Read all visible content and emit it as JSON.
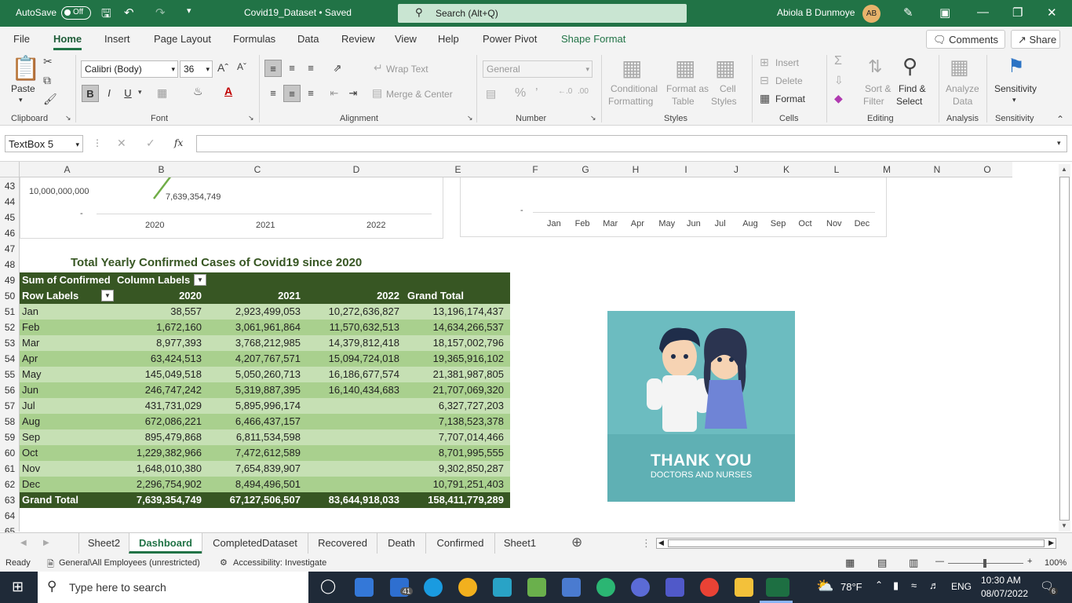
{
  "titlebar": {
    "autosave_label": "AutoSave",
    "autosave_state": "Off",
    "doc_title": "Covid19_Dataset • Saved",
    "search_placeholder": "Search (Alt+Q)",
    "user_name": "Abiola B Dunmoye",
    "user_initials": "AB"
  },
  "menu": {
    "items": [
      "File",
      "Home",
      "Insert",
      "Page Layout",
      "Formulas",
      "Data",
      "Review",
      "View",
      "Help",
      "Power Pivot",
      "Shape Format"
    ],
    "comments": "Comments",
    "share": "Share"
  },
  "ribbon": {
    "clipboard": {
      "paste": "Paste",
      "group": "Clipboard"
    },
    "font": {
      "family": "Calibri (Body)",
      "size": "36",
      "bold": "B",
      "italic": "I",
      "underline": "U",
      "group": "Font"
    },
    "alignment": {
      "wrap": "Wrap Text",
      "merge": "Merge & Center",
      "group": "Alignment"
    },
    "number": {
      "format": "General",
      "group": "Number"
    },
    "styles": {
      "conditional1": "Conditional",
      "conditional2": "Formatting",
      "format_as1": "Format as",
      "format_as2": "Table",
      "cell_styles1": "Cell",
      "cell_styles2": "Styles",
      "group": "Styles"
    },
    "cells": {
      "insert": "Insert",
      "delete": "Delete",
      "format": "Format",
      "group": "Cells"
    },
    "editing": {
      "sort1": "Sort &",
      "sort2": "Filter",
      "find1": "Find &",
      "find2": "Select",
      "group": "Editing"
    },
    "analysis": {
      "analyze1": "Analyze",
      "analyze2": "Data",
      "group": "Analysis"
    },
    "sensitivity": {
      "label": "Sensitivity",
      "group": "Sensitivity"
    }
  },
  "formula_bar": {
    "name_box": "TextBox 5",
    "fx": "fx",
    "formula": ""
  },
  "columns": [
    "A",
    "B",
    "C",
    "D",
    "E",
    "F",
    "G",
    "H",
    "I",
    "J",
    "K",
    "L",
    "M",
    "N",
    "O"
  ],
  "rows": [
    "43",
    "44",
    "45",
    "46",
    "47",
    "48",
    "49",
    "50",
    "51",
    "52",
    "53",
    "54",
    "55",
    "56",
    "57",
    "58",
    "59",
    "60",
    "61",
    "62",
    "63",
    "64",
    "65"
  ],
  "left_chart": {
    "y_tick_top": "10,000,000,000",
    "y_tick_zero": "-",
    "data_label": "7,639,354,749",
    "x_ticks": [
      "2020",
      "2021",
      "2022"
    ]
  },
  "right_chart": {
    "y_tick_zero": "-",
    "x_ticks": [
      "Jan",
      "Feb",
      "Mar",
      "Apr",
      "May",
      "Jun",
      "Jul",
      "Aug",
      "Sep",
      "Oct",
      "Nov",
      "Dec"
    ]
  },
  "pivot": {
    "title": "Total Yearly Confirmed Cases of Covid19 since 2020",
    "sum_label": "Sum of Confirmed",
    "col_labels": "Column Labels",
    "row_labels": "Row Labels",
    "headers": [
      "2020",
      "2021",
      "2022",
      "Grand Total"
    ],
    "rows": [
      {
        "m": "Jan",
        "y2020": "38,557",
        "y2021": "2,923,499,053",
        "y2022": "10,272,636,827",
        "total": "13,196,174,437"
      },
      {
        "m": "Feb",
        "y2020": "1,672,160",
        "y2021": "3,061,961,864",
        "y2022": "11,570,632,513",
        "total": "14,634,266,537"
      },
      {
        "m": "Mar",
        "y2020": "8,977,393",
        "y2021": "3,768,212,985",
        "y2022": "14,379,812,418",
        "total": "18,157,002,796"
      },
      {
        "m": "Apr",
        "y2020": "63,424,513",
        "y2021": "4,207,767,571",
        "y2022": "15,094,724,018",
        "total": "19,365,916,102"
      },
      {
        "m": "May",
        "y2020": "145,049,518",
        "y2021": "5,050,260,713",
        "y2022": "16,186,677,574",
        "total": "21,381,987,805"
      },
      {
        "m": "Jun",
        "y2020": "246,747,242",
        "y2021": "5,319,887,395",
        "y2022": "16,140,434,683",
        "total": "21,707,069,320"
      },
      {
        "m": "Jul",
        "y2020": "431,731,029",
        "y2021": "5,895,996,174",
        "y2022": "",
        "total": "6,327,727,203"
      },
      {
        "m": "Aug",
        "y2020": "672,086,221",
        "y2021": "6,466,437,157",
        "y2022": "",
        "total": "7,138,523,378"
      },
      {
        "m": "Sep",
        "y2020": "895,479,868",
        "y2021": "6,811,534,598",
        "y2022": "",
        "total": "7,707,014,466"
      },
      {
        "m": "Oct",
        "y2020": "1,229,382,966",
        "y2021": "7,472,612,589",
        "y2022": "",
        "total": "8,701,995,555"
      },
      {
        "m": "Nov",
        "y2020": "1,648,010,380",
        "y2021": "7,654,839,907",
        "y2022": "",
        "total": "9,302,850,287"
      },
      {
        "m": "Dec",
        "y2020": "2,296,754,902",
        "y2021": "8,494,496,501",
        "y2022": "",
        "total": "10,791,251,403"
      }
    ],
    "grand": {
      "m": "Grand Total",
      "y2020": "7,639,354,749",
      "y2021": "67,127,506,507",
      "y2022": "83,644,918,033",
      "total": "158,411,779,289"
    }
  },
  "image_card": {
    "line1": "THANK YOU",
    "line2": "DOCTORS AND NURSES"
  },
  "sheet_tabs": [
    "Sheet2",
    "Dashboard",
    "CompletedDataset",
    "Recovered",
    "Death",
    "Confirmed",
    "Sheet1"
  ],
  "active_tab": "Dashboard",
  "status": {
    "ready": "Ready",
    "label": "General\\All Employees (unrestricted)",
    "accessibility": "Accessibility: Investigate",
    "zoom": "100%"
  },
  "taskbar": {
    "search": "Type here to search",
    "temp": "78°F",
    "lang": "ENG",
    "time": "10:30 AM",
    "date": "08/07/2022",
    "mail_badge": "41",
    "notif": "6"
  },
  "colors": {
    "excel_green": "#217346",
    "pivot_dark": "#375623",
    "pivot_light": "#c6e0b4",
    "pivot_mid": "#a9d08e",
    "card_teal": "#6cbcc0"
  }
}
